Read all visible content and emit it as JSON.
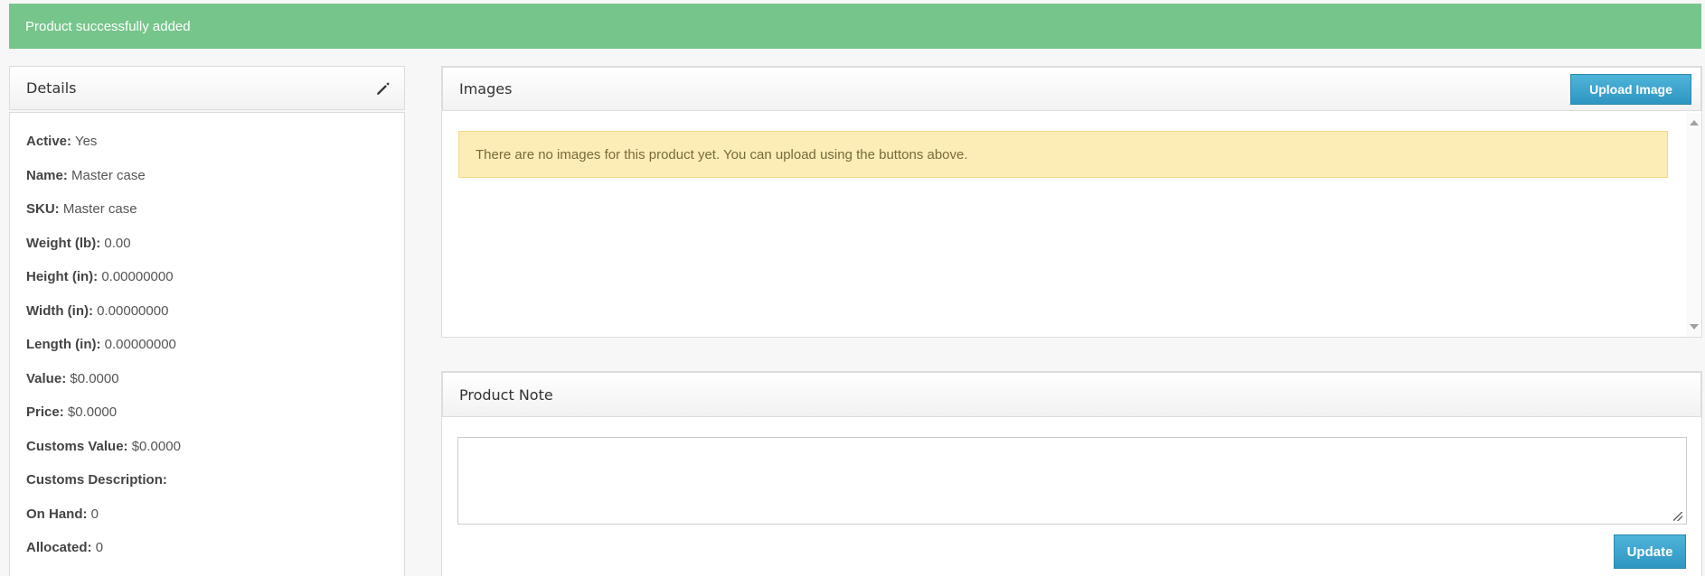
{
  "alert": {
    "success_text": "Product successfully added"
  },
  "details": {
    "title": "Details",
    "edit_icon": "pencil-icon",
    "rows": [
      {
        "label": "Active:",
        "value": "Yes"
      },
      {
        "label": "Name:",
        "value": "Master case"
      },
      {
        "label": "SKU:",
        "value": "Master case"
      },
      {
        "label": "Weight (lb):",
        "value": "0.00"
      },
      {
        "label": "Height (in):",
        "value": "0.00000000"
      },
      {
        "label": "Width (in):",
        "value": "0.00000000"
      },
      {
        "label": "Length (in):",
        "value": "0.00000000"
      },
      {
        "label": "Value:",
        "value": "$0.0000"
      },
      {
        "label": "Price:",
        "value": "$0.0000"
      },
      {
        "label": "Customs Value:",
        "value": "$0.0000"
      },
      {
        "label": "Customs Description:",
        "value": ""
      },
      {
        "label": "On Hand:",
        "value": "0"
      },
      {
        "label": "Allocated:",
        "value": "0"
      }
    ]
  },
  "images": {
    "title": "Images",
    "upload_label": "Upload Image",
    "empty_message": "There are no images for this product yet. You can upload using the buttons above."
  },
  "note": {
    "title": "Product Note",
    "text": "",
    "update_label": "Update"
  },
  "colors": {
    "success": "#76c58b",
    "warning_bg": "#fcecb6",
    "button": "#2f96c3"
  }
}
